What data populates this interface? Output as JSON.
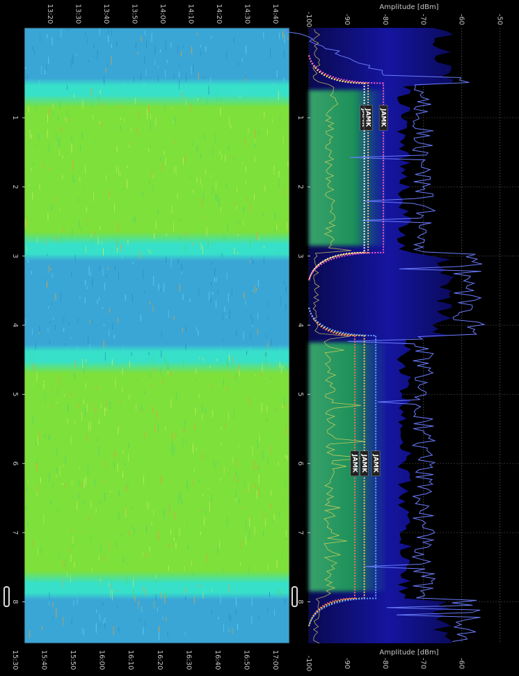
{
  "chart_data": [
    {
      "type": "heatmap",
      "name": "waterfall",
      "time_ticks_top": [
        "13:20",
        "13:30",
        "13:40",
        "13:50",
        "14:00",
        "14:10",
        "14:20",
        "14:30",
        "14:40"
      ],
      "time_ticks_bottom": [
        "15:30",
        "15:40",
        "15:50",
        "16:00",
        "16:10",
        "16:20",
        "16:30",
        "16:40",
        "16:50",
        "17:00"
      ],
      "freq_ticks": [
        "1",
        "2",
        "3",
        "4",
        "5",
        "6",
        "7",
        "8"
      ],
      "bands": [
        {
          "from": 0.55,
          "to": 2.95,
          "level": "high"
        },
        {
          "from": 4.4,
          "to": 7.85,
          "level": "high"
        }
      ],
      "colors": {
        "low": "#3aa6d6",
        "mid": "#37e0c9",
        "high": "#7ee03a"
      }
    },
    {
      "type": "line",
      "name": "spectrum",
      "axis_label": "Amplitude [dBm]",
      "amp_ticks_top": [
        "-100",
        "-90",
        "-80",
        "-70",
        "-60",
        "-50"
      ],
      "amp_ticks_bottom": [
        "-100",
        "-90",
        "-80",
        "-70",
        "-60"
      ],
      "amp_range": [
        -100,
        -45
      ],
      "freq_ticks": [
        "1",
        "2",
        "3",
        "4",
        "5",
        "6",
        "7",
        "8"
      ],
      "freq_range": [
        -0.3,
        8.6
      ],
      "masks": [
        {
          "label": "JAMK",
          "from": 0.5,
          "to": 2.95,
          "level": -85.5,
          "color": "#ffffff"
        },
        {
          "label": "JAMK",
          "from": 0.5,
          "to": 2.95,
          "level": -84.5,
          "color": "#ffd23a"
        },
        {
          "label": "JAMK",
          "from": 0.5,
          "to": 2.95,
          "level": -80.5,
          "color": "#ff5ad0"
        },
        {
          "label": "JAMK",
          "from": 4.15,
          "to": 7.95,
          "level": -88.0,
          "color": "#ff6a6a"
        },
        {
          "label": "JAMK",
          "from": 4.15,
          "to": 7.95,
          "level": -85.5,
          "color": "#ffd23a"
        },
        {
          "label": "JAMK",
          "from": 4.15,
          "to": 7.95,
          "level": -82.5,
          "color": "#6aa8ff"
        }
      ],
      "colors": {
        "background": "#000000",
        "noise": "#1a1ab0",
        "signal": "#1fae4a",
        "trace": "#6a7cff"
      }
    }
  ]
}
